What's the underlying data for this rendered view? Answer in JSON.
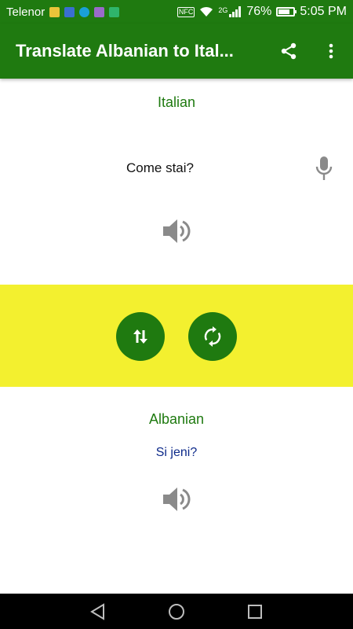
{
  "status_bar": {
    "carrier": "Telenor",
    "network": "2G",
    "battery_level": 0.76,
    "battery_percent": "76%",
    "time": "5:05 PM",
    "notification_icons": [
      "broom-icon",
      "messenger-icon",
      "chat-icon",
      "gallery-icon",
      "download-icon"
    ],
    "system_icons": [
      "nfc-icon",
      "wifi-icon",
      "signal-icon",
      "battery-icon"
    ],
    "nfc_label": "NFC"
  },
  "app_bar": {
    "title": "Translate Albanian to Ital...",
    "actions": [
      "share-icon",
      "more-vert-icon"
    ]
  },
  "source": {
    "language": "Italian",
    "text": "Come stai?"
  },
  "target": {
    "language": "Albanian",
    "text": "Si jeni?"
  },
  "controls": {
    "swap_icon": "swap-vertical-icon",
    "refresh_icon": "refresh-icon"
  },
  "nav_bar": {
    "buttons": [
      "back-icon",
      "home-icon",
      "recents-icon"
    ]
  },
  "colors": {
    "primary": "#1f7a10",
    "band": "#f3f02f",
    "translated_text": "#0d2a8a",
    "icon_gray": "#8a8a8a"
  }
}
